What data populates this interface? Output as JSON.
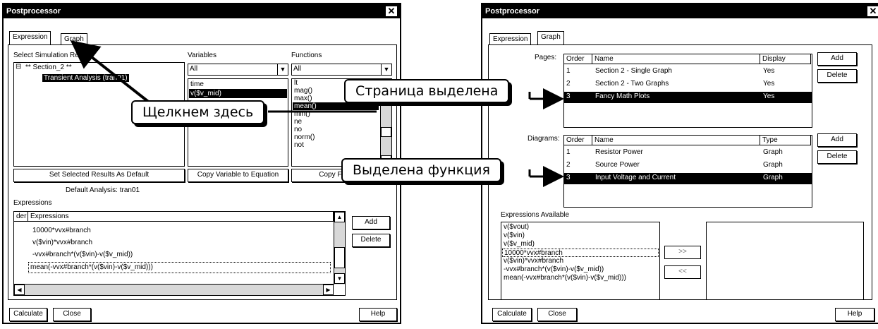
{
  "left": {
    "title": "Postprocessor",
    "close_glyph": "✕",
    "tabs": [
      "Expression",
      "Graph"
    ],
    "select_results_label": "Select Simulation Results",
    "tree": {
      "root": "** Section_2 **",
      "child": "Transient Analysis (tran01)",
      "expander": "⊟"
    },
    "variables_label": "Variables",
    "variables_filter": "All",
    "variables": [
      "time",
      "v($v_mid)"
    ],
    "functions_label": "Functions",
    "functions_filter": "All",
    "functions": [
      "lt",
      "mag()",
      "max()",
      "mean()",
      "min()",
      "ne",
      "no",
      "norm()",
      "not"
    ],
    "btn_set_default": "Set Selected Results As Default",
    "btn_copy_variable": "Copy Variable to Equation",
    "btn_copy_function": "Copy Function",
    "default_analysis": "Default Analysis: tran01",
    "expressions_label": "Expressions",
    "expr_headers": [
      "der",
      "Expressions"
    ],
    "expressions": [
      "10000*vvx#branch",
      "v($vin)*vvx#branch",
      "-vvx#branch*(v($vin)-v($v_mid))",
      "mean(-vvx#branch*(v($vin)-v($v_mid)))"
    ],
    "btn_add": "Add",
    "btn_delete": "Delete",
    "btn_calculate": "Calculate",
    "btn_close": "Close",
    "btn_help": "Help"
  },
  "right": {
    "title": "Postprocessor",
    "close_glyph": "✕",
    "tabs": [
      "Expression",
      "Graph"
    ],
    "pages_label": "Pages:",
    "pages_headers": [
      "Order",
      "Name",
      "Display"
    ],
    "pages": [
      {
        "order": "1",
        "name": "Section 2 - Single Graph",
        "display": "Yes"
      },
      {
        "order": "2",
        "name": "Section 2 - Two Graphs",
        "display": "Yes"
      },
      {
        "order": "3",
        "name": "Fancy Math Plots",
        "display": "Yes"
      }
    ],
    "diagrams_label": "Diagrams:",
    "diagrams_headers": [
      "Order",
      "Name",
      "Type"
    ],
    "diagrams": [
      {
        "order": "1",
        "name": "Resistor Power",
        "type": "Graph"
      },
      {
        "order": "2",
        "name": "Source Power",
        "type": "Graph"
      },
      {
        "order": "3",
        "name": "Input Voltage and Current",
        "type": "Graph"
      }
    ],
    "btn_add": "Add",
    "btn_delete": "Delete",
    "expressions_available_label": "Expressions Available",
    "expressions_available": [
      "v($vout)",
      "v($vin)",
      "v($v_mid)",
      "10000*vvx#branch",
      "v($vin)*vvx#branch",
      "-vvx#branch*(v($vin)-v($v_mid))",
      "mean(-vvx#branch*(v($vin)-v($v_mid)))"
    ],
    "btn_move_right": ">>",
    "btn_move_left": "<<",
    "btn_calculate": "Calculate",
    "btn_close": "Close",
    "btn_help": "Help"
  },
  "callouts": {
    "click_here": "Щелкнем здесь",
    "page_selected": "Страница выделена",
    "function_selected": "Выделена функция"
  }
}
